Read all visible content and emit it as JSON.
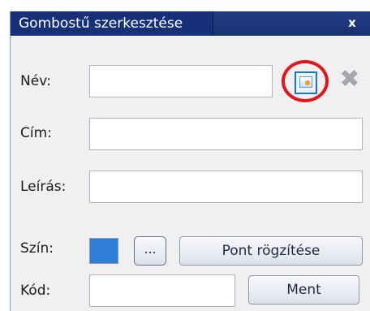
{
  "dialog": {
    "title": "Gombostű szerkesztése",
    "close_glyph": "x"
  },
  "fields": {
    "name_label": "Név:",
    "title_label": "Cím:",
    "description_label": "Leírás:",
    "color_label": "Szín:",
    "code_label": "Kód:"
  },
  "color": {
    "swatch": "#2f7fd7",
    "picker_label": "..."
  },
  "buttons": {
    "record_point": "Pont rögzítése",
    "save": "Ment",
    "delete_glyph": "✖"
  },
  "icons": {
    "pick_icon": "pick-icon",
    "delete": "delete-icon",
    "close": "close-icon"
  },
  "annotation": {
    "highlight_color": "#e0161b"
  }
}
